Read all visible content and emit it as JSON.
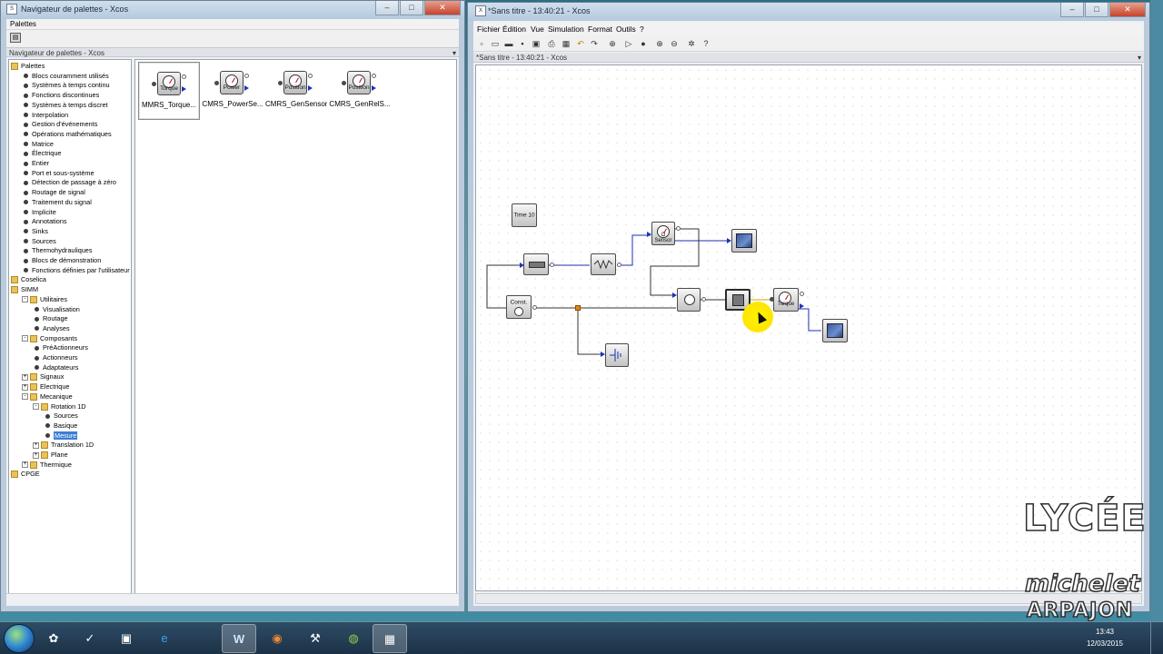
{
  "palette_window": {
    "title": "Navigateur de palettes - Xcos",
    "menu": "Palettes",
    "subtitle": "Navigateur de palettes - Xcos",
    "pin": "▾",
    "win_minimize": "–",
    "win_maximize": "□",
    "win_close": "✕",
    "tree": [
      {
        "label": "Palettes",
        "level": 0,
        "type": "folder",
        "expander": ""
      },
      {
        "label": "Blocs couramment utilisés",
        "level": 1,
        "type": "leaf"
      },
      {
        "label": "Systèmes à temps continu",
        "level": 1,
        "type": "leaf"
      },
      {
        "label": "Fonctions discontinues",
        "level": 1,
        "type": "leaf"
      },
      {
        "label": "Systèmes à temps discret",
        "level": 1,
        "type": "leaf"
      },
      {
        "label": "Interpolation",
        "level": 1,
        "type": "leaf"
      },
      {
        "label": "Gestion d'événements",
        "level": 1,
        "type": "leaf"
      },
      {
        "label": "Opérations mathématiques",
        "level": 1,
        "type": "leaf"
      },
      {
        "label": "Matrice",
        "level": 1,
        "type": "leaf"
      },
      {
        "label": "Électrique",
        "level": 1,
        "type": "leaf"
      },
      {
        "label": "Entier",
        "level": 1,
        "type": "leaf"
      },
      {
        "label": "Port et sous-système",
        "level": 1,
        "type": "leaf"
      },
      {
        "label": "Détection de passage à zéro",
        "level": 1,
        "type": "leaf"
      },
      {
        "label": "Routage de signal",
        "level": 1,
        "type": "leaf"
      },
      {
        "label": "Traitement du signal",
        "level": 1,
        "type": "leaf"
      },
      {
        "label": "Implicite",
        "level": 1,
        "type": "leaf"
      },
      {
        "label": "Annotations",
        "level": 1,
        "type": "leaf"
      },
      {
        "label": "Sinks",
        "level": 1,
        "type": "leaf"
      },
      {
        "label": "Sources",
        "level": 1,
        "type": "leaf"
      },
      {
        "label": "Thermohydrauliques",
        "level": 1,
        "type": "leaf"
      },
      {
        "label": "Blocs de démonstration",
        "level": 1,
        "type": "leaf"
      },
      {
        "label": "Fonctions définies par l'utilisateur",
        "level": 1,
        "type": "leaf"
      },
      {
        "label": "Coselica",
        "level": 0,
        "type": "folder"
      },
      {
        "label": "SIMM",
        "level": 0,
        "type": "folder"
      },
      {
        "label": "Utilitaires",
        "level": 1,
        "type": "folder",
        "expander": "-"
      },
      {
        "label": "Visualisation",
        "level": 2,
        "type": "leaf"
      },
      {
        "label": "Routage",
        "level": 2,
        "type": "leaf"
      },
      {
        "label": "Analyses",
        "level": 2,
        "type": "leaf"
      },
      {
        "label": "Composants",
        "level": 1,
        "type": "folder",
        "expander": "-"
      },
      {
        "label": "PréActionneurs",
        "level": 2,
        "type": "leaf"
      },
      {
        "label": "Actionneurs",
        "level": 2,
        "type": "leaf"
      },
      {
        "label": "Adaptateurs",
        "level": 2,
        "type": "leaf"
      },
      {
        "label": "Signaux",
        "level": 1,
        "type": "folder",
        "expander": "+"
      },
      {
        "label": "Electrique",
        "level": 1,
        "type": "folder",
        "expander": "+"
      },
      {
        "label": "Mecanique",
        "level": 1,
        "type": "folder",
        "expander": "-"
      },
      {
        "label": "Rotation 1D",
        "level": 2,
        "type": "folder",
        "expander": "-"
      },
      {
        "label": "Sources",
        "level": 3,
        "type": "leaf"
      },
      {
        "label": "Basique",
        "level": 3,
        "type": "leaf"
      },
      {
        "label": "Mesure",
        "level": 3,
        "type": "leaf",
        "selected": true
      },
      {
        "label": "Translation 1D",
        "level": 2,
        "type": "folder",
        "expander": "+"
      },
      {
        "label": "Plane",
        "level": 2,
        "type": "folder",
        "expander": "+"
      },
      {
        "label": "Thermique",
        "level": 1,
        "type": "folder",
        "expander": "+"
      },
      {
        "label": "CPGE",
        "level": 0,
        "type": "folder"
      }
    ],
    "blocks": [
      {
        "caption": "MMRS_Torque...",
        "face": "Torque",
        "selected": true
      },
      {
        "caption": "CMRS_PowerSe...",
        "face": "Power"
      },
      {
        "caption": "CMRS_GenSensor",
        "face": "Position"
      },
      {
        "caption": "CMRS_GenRelS...",
        "face": "Position"
      }
    ]
  },
  "xcos_window": {
    "title": "*Sans titre - 13:40:21 - Xcos",
    "subtitle": "*Sans titre - 13:40:21 - Xcos",
    "pin": "▾",
    "win_minimize": "–",
    "win_maximize": "□",
    "win_close": "✕",
    "menus": [
      "Fichier",
      "Édition",
      "Vue",
      "Simulation",
      "Format",
      "Outils",
      "?"
    ],
    "toolbar_icons": [
      "new-icon",
      "open-icon",
      "open-folder-icon",
      "save-icon",
      "save-as-icon",
      "print-icon",
      "delete-icon",
      "undo-icon",
      "redo-icon",
      "fit-icon",
      "start-icon",
      "stop-icon",
      "zoom-in-icon",
      "zoom-out-icon",
      "xcos-icon",
      "help-icon"
    ],
    "diagram": {
      "time_block_label": "Time 10",
      "const_label": "Const.",
      "sensor1_label": "Ω Sensor",
      "torque_label": "Torque"
    }
  },
  "watermark": {
    "line1": "LYCÉE",
    "line2": "michelet",
    "line3": "ARPAJON"
  },
  "taskbar": {
    "clock_time": "13:43",
    "clock_date": "12/03/2015",
    "apps": [
      "start-menu",
      "scilab-icon",
      "onenote-icon",
      "ie-icon",
      "word-icon",
      "firefox-icon",
      "tools-icon",
      "globe-icon",
      "xcos-icon"
    ]
  }
}
